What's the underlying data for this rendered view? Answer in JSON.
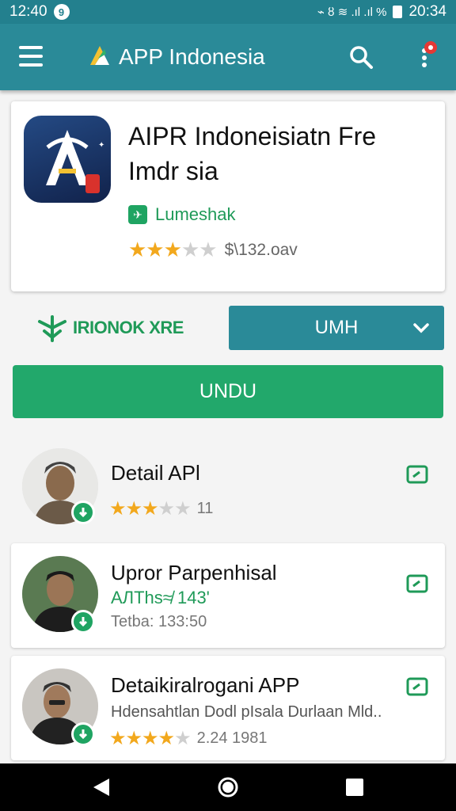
{
  "status_bar": {
    "time": "12:40",
    "notification_badge": "9",
    "right_clock": "20:34",
    "right_glyphs": "⌁ ȣ ≋ .ıl .ıl %"
  },
  "app_bar": {
    "title": "APP Indonesia",
    "icons": [
      "menu-icon",
      "app-logo-icon",
      "search-icon",
      "notification-icon"
    ]
  },
  "hero": {
    "title_line1": "AIPR Indoneisiatn Fre",
    "title_line2": "Imdr  sia",
    "developer": "Lumeshak",
    "rating_stars": 3,
    "rating_text": "$\\132.oav"
  },
  "actions": {
    "brand_text": "IRIONOK XRE",
    "select_value": "UMH",
    "download_label": "UNDU"
  },
  "list": [
    {
      "title": "Detail APl",
      "rating_stars": 3,
      "rating_text": "11",
      "subtitle": "",
      "meta": ""
    },
    {
      "title": "Upror Parpenhisal",
      "subtitle": "AЛThs≉ 143'",
      "meta": "Tetba: 133:50"
    },
    {
      "title": "Detaikiralrogani APP",
      "subtitle": "Hdensahtlan Dodl pIsala Durlaan Mld..",
      "rating_stars": 4,
      "rating_text": "2.24 1981"
    }
  ],
  "colors": {
    "primary": "#2a8a98",
    "green": "#22a86b",
    "star": "#f2a81d"
  },
  "nav": {
    "icons": [
      "back-icon",
      "home-icon",
      "recents-icon"
    ]
  }
}
